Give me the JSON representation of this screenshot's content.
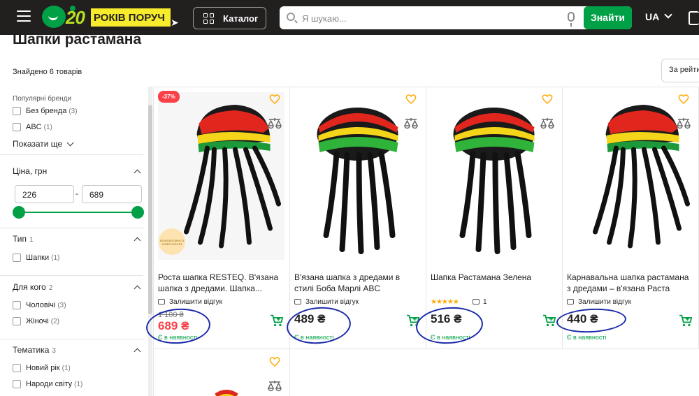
{
  "header": {
    "logo_number": "20",
    "logo_text": "РОКІВ ПОРУЧ",
    "catalog_label": "Каталог",
    "search_placeholder": "Я шукаю...",
    "search_button": "Знайти",
    "language": "UA",
    "brand_color": "#00a046"
  },
  "page": {
    "title": "Шапки растамана",
    "found_text": "Знайдено 6 товарів",
    "sort_label": "За рейти"
  },
  "sidebar": {
    "brands_title": "Популярні бренди",
    "brands": [
      {
        "label": "Без бренда",
        "count": "(3)"
      },
      {
        "label": "ABC",
        "count": "(1)"
      }
    ],
    "show_more": "Показати ще",
    "price_title": "Ціна, грн",
    "price_min": "226",
    "price_max": "689",
    "price_dash": "-",
    "type_title": "Тип",
    "type_count": "1",
    "types": [
      {
        "label": "Шапки",
        "count": "(1)"
      }
    ],
    "for_whom_title": "Для кого",
    "for_whom_count": "2",
    "for_whom": [
      {
        "label": "Чоловічі",
        "count": "(3)"
      },
      {
        "label": "Жіночі",
        "count": "(2)"
      }
    ],
    "theme_title": "Тематика",
    "theme_count": "3",
    "themes": [
      {
        "label": "Новий рік",
        "count": "(1)"
      },
      {
        "label": "Народи світу",
        "count": "(1)"
      }
    ]
  },
  "products": [
    {
      "discount": "-37%",
      "promo": "БЕЗКОШТОВНО З НОВОЇ ПОШТИ",
      "name": "Роста шапка RESTEQ. В'язана шапка з дредами. Шапка...",
      "review": "Залишити відгук",
      "old_price": "1 100 ₴",
      "price": "689 ₴",
      "stock": "Є в наявності"
    },
    {
      "name": "В'язана шапка з дредами в стилі Боба Марлі ABC розтаманка",
      "review": "Залишити відгук",
      "price": "489 ₴",
      "stock": "Є в наявності"
    },
    {
      "name": "Шапка Растамана Зелена",
      "rating": "★★★★★",
      "review_count": "1",
      "price": "516 ₴",
      "stock": "Є в наявності"
    },
    {
      "name": "Карнавальна шапка растамана з дредами – в'язана Раста шапка в...",
      "review": "Залишити відгук",
      "price": "440 ₴",
      "stock": "Є в наявності"
    }
  ],
  "icons": {
    "heart": "heart-icon",
    "compare": "compare-icon",
    "cart": "cart-icon",
    "search": "search-icon",
    "mic": "mic-icon"
  },
  "colors": {
    "accent": "#00a046",
    "sale": "#f84147",
    "heart": "#ffa900",
    "annotation": "#1a2aa8"
  }
}
